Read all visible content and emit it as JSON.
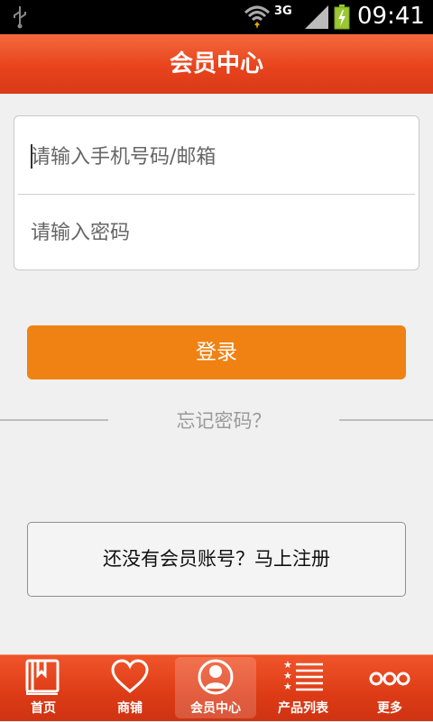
{
  "status_bar": {
    "network": "3G",
    "time": "09:41"
  },
  "header": {
    "title": "会员中心"
  },
  "login_form": {
    "account_placeholder": "请输入手机号码/邮箱",
    "password_placeholder": "请输入密码",
    "login_label": "登录",
    "forgot_label": "忘记密码？"
  },
  "register": {
    "label": "还没有会员账号？马上注册"
  },
  "tabs": [
    {
      "label": "首页",
      "icon": "book-icon"
    },
    {
      "label": "商铺",
      "icon": "heart-icon"
    },
    {
      "label": "会员中心",
      "icon": "user-icon",
      "active": true
    },
    {
      "label": "产品列表",
      "icon": "list-icon"
    },
    {
      "label": "更多",
      "icon": "more-icon"
    }
  ],
  "colors": {
    "header": "#e8431d",
    "accent_button": "#f08213",
    "tabbar": "#dd3b16"
  }
}
